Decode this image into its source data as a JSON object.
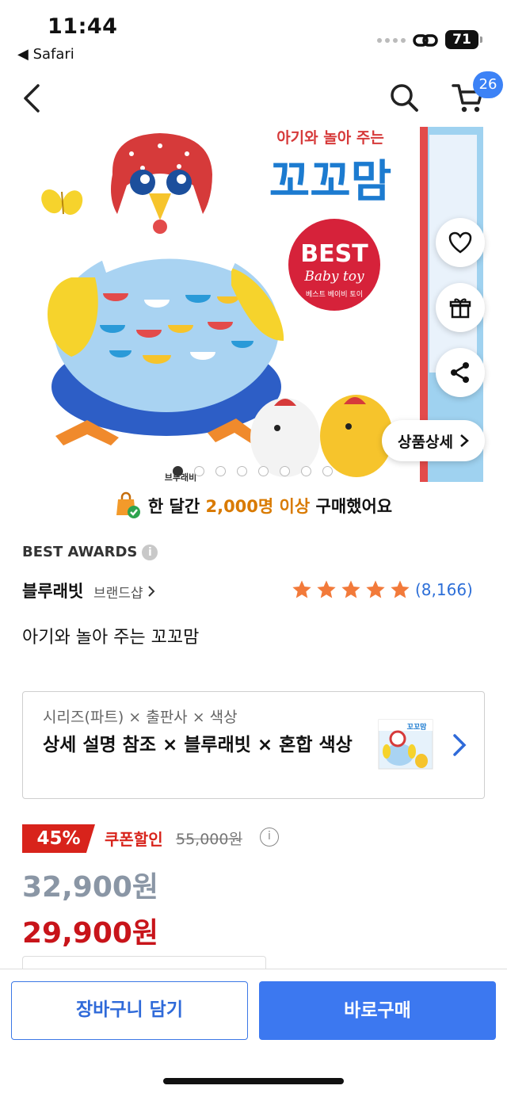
{
  "status_bar": {
    "time": "11:44",
    "back_app": "◀ Safari",
    "battery": "71"
  },
  "nav": {
    "cart_count": "26",
    "icons": [
      "back-arrow-icon",
      "search-icon",
      "cart-icon"
    ]
  },
  "hero": {
    "headline_small": "아기와 놀아 주는",
    "headline_big": "꼬꼬맘",
    "badge_best": "BEST",
    "badge_script": "Baby toy",
    "badge_caption": "베스트 베이비 토이",
    "brand_mark": "브루래비",
    "detail_button": "상품상세",
    "image_count": 8,
    "active_index": 0
  },
  "purchase_notice": {
    "prefix": "한 달간 ",
    "highlight": "2,000명 이상",
    "suffix": " 구매했어요"
  },
  "awards": {
    "label": "BEST AWARDS",
    "info": "i"
  },
  "brand": {
    "name": "블루래빗",
    "shop": "브랜드샵"
  },
  "rating": {
    "stars": 5,
    "review_count": "(8,166)"
  },
  "product_title": "아기와 놀아 주는 꼬꼬맘",
  "option": {
    "label": "시리즈(파트) × 출판사 × 색상",
    "value": "상세 설명 참조 × 블루래빗 × 혼합 색상",
    "thumb_text": "꼬꼬맘"
  },
  "price": {
    "discount": "45%",
    "coupon_label": "쿠폰할인",
    "original": "55,000원",
    "info": "i",
    "sale": "32,900원",
    "coupon_price": "29,900원"
  },
  "actions": {
    "add_to_cart": "장바구니 담기",
    "buy_now": "바로구매"
  },
  "colors": {
    "accent": "#3c78f0",
    "discount_red": "#d8231b",
    "highlight_orange": "#d97a00",
    "star": "#f27a3a"
  }
}
